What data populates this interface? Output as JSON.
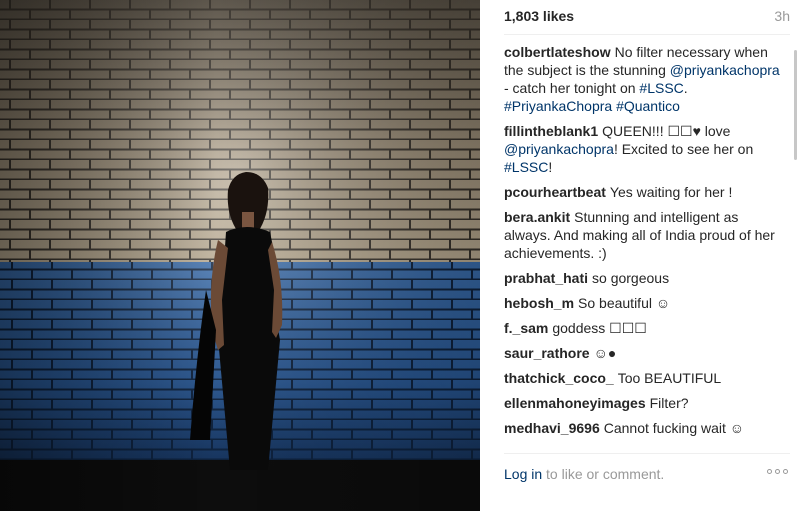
{
  "post": {
    "likes": "1,803 likes",
    "time": "3h"
  },
  "comments": [
    {
      "user": "colbertlateshow",
      "parts": [
        {
          "t": "No filter necessary when the subject is the stunning "
        },
        {
          "t": "@priyankachopra",
          "tag": true
        },
        {
          "t": " - catch her tonight on "
        },
        {
          "t": "#LSSC",
          "tag": true
        },
        {
          "t": ". "
        },
        {
          "t": "#PriyankaChopra",
          "tag": true
        },
        {
          "t": " "
        },
        {
          "t": "#Quantico",
          "tag": true
        }
      ]
    },
    {
      "user": "fillintheblank1",
      "parts": [
        {
          "t": "QUEEN!!! ☐☐♥ love "
        },
        {
          "t": "@priyankachopra",
          "tag": true
        },
        {
          "t": "! Excited to see her on "
        },
        {
          "t": "#LSSC",
          "tag": true
        },
        {
          "t": "!"
        }
      ]
    },
    {
      "user": "pcourheartbeat",
      "parts": [
        {
          "t": "Yes waiting for her !"
        }
      ]
    },
    {
      "user": "bera.ankit",
      "parts": [
        {
          "t": "Stunning and intelligent as always. And making all of India proud of her achievements. :)"
        }
      ]
    },
    {
      "user": "prabhat_hati",
      "parts": [
        {
          "t": "so gorgeous"
        }
      ]
    },
    {
      "user": "hebosh_m",
      "parts": [
        {
          "t": "So beautiful ☺"
        }
      ]
    },
    {
      "user": "f._sam",
      "parts": [
        {
          "t": "goddess ☐☐☐"
        }
      ]
    },
    {
      "user": "saur_rathore",
      "parts": [
        {
          "t": "☺●"
        }
      ]
    },
    {
      "user": "thatchick_coco_",
      "parts": [
        {
          "t": "Too BEAUTIFUL"
        }
      ]
    },
    {
      "user": "ellenmahoneyimages",
      "parts": [
        {
          "t": "Filter?"
        }
      ]
    },
    {
      "user": "medhavi_9696",
      "parts": [
        {
          "t": "Cannot fucking wait ☺"
        }
      ]
    }
  ],
  "footer": {
    "login_link": "Log in",
    "login_text": " to like or comment."
  },
  "colors": {
    "link": "#003569",
    "brick_blue": "#2a5fa3",
    "brick_warm": "#b9a78c"
  }
}
